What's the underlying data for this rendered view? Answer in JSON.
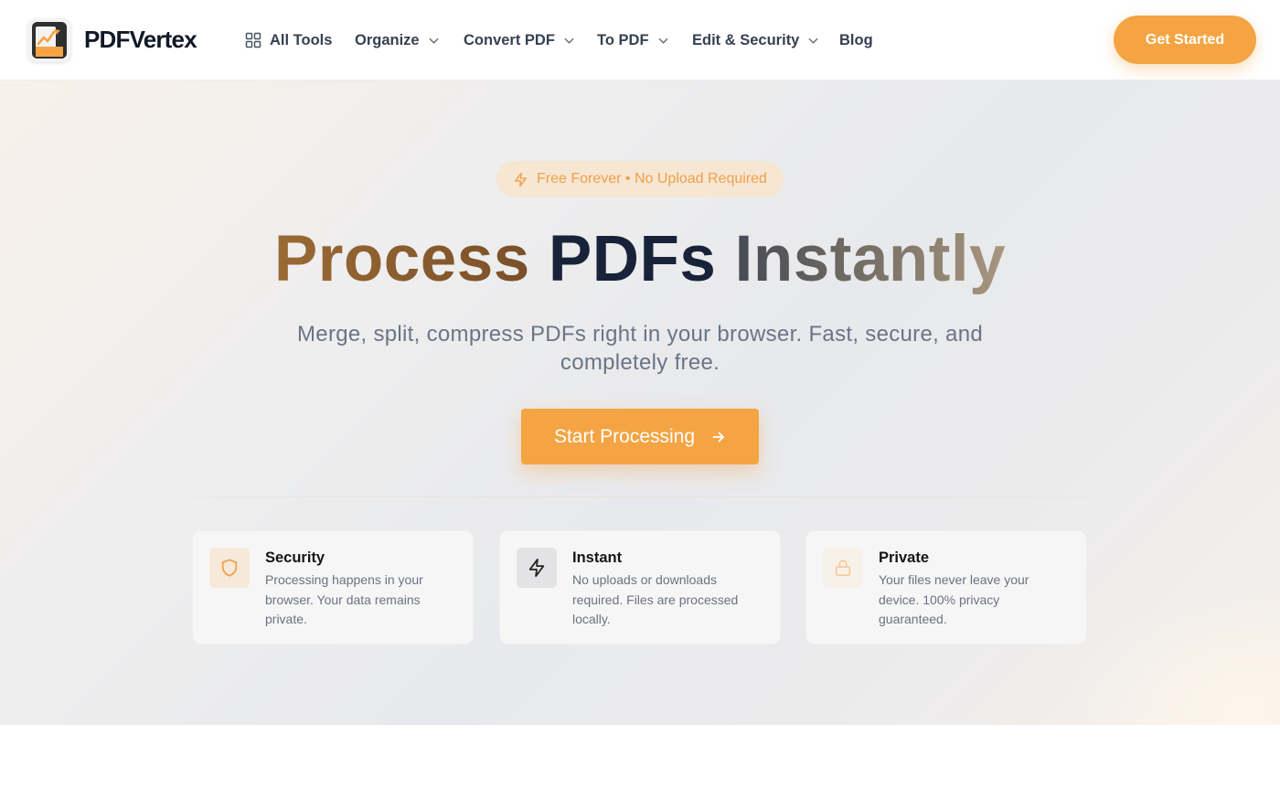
{
  "brand": {
    "name": "PDFVertex",
    "logo_text": "PDF VERTEX"
  },
  "nav": {
    "items": [
      {
        "label": "All Tools",
        "icon": "grid-icon"
      },
      {
        "label": "Organize",
        "icon": "chevron-down-icon"
      },
      {
        "label": "Convert PDF",
        "icon": "chevron-down-icon"
      },
      {
        "label": "To PDF",
        "icon": "chevron-down-icon"
      },
      {
        "label": "Edit & Security",
        "icon": "chevron-down-icon"
      },
      {
        "label": "Blog"
      }
    ],
    "cta_label": "Get Started"
  },
  "hero": {
    "badge": "Free Forever • No Upload Required",
    "headline": {
      "word1": "Process",
      "word2": "PDFs",
      "word3": "Instantly"
    },
    "subtitle": "Merge, split, compress PDFs right in your browser. Fast, secure, and completely free.",
    "cta_label": "Start Processing"
  },
  "features": [
    {
      "title": "Security",
      "description": "Processing happens in your browser. Your data remains private.",
      "icon": "shield-icon"
    },
    {
      "title": "Instant",
      "description": "No uploads or downloads required. Files are processed locally.",
      "icon": "lightning-icon"
    },
    {
      "title": "Private",
      "description": "Your files never leave your device. 100% privacy guaranteed.",
      "icon": "lock-icon"
    }
  ],
  "colors": {
    "accent": "#f4a443",
    "text_dark": "#18233a",
    "muted": "#6b7486"
  }
}
